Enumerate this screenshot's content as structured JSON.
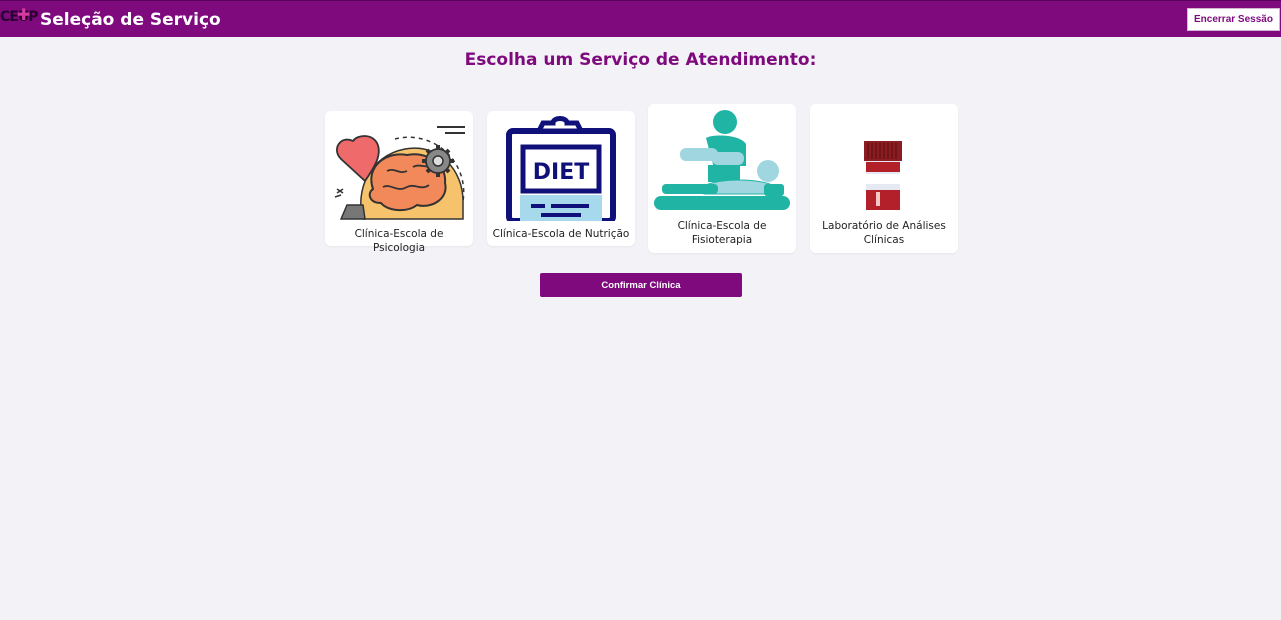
{
  "header": {
    "logo_text": "CEUP",
    "title": "Seleção de Serviço",
    "logout_label": "Encerrar Sessão",
    "background_color": "#7e0a7e"
  },
  "main": {
    "heading": "Escolha um Serviço de Atendimento:",
    "services": [
      {
        "label": "Clínica-Escola de Psicologia",
        "icon": "brain-heart-gear-icon"
      },
      {
        "label": "Clínica-Escola de Nutrição",
        "icon": "diet-clipboard-icon"
      },
      {
        "label": "Clínica-Escola de Fisioterapia",
        "icon": "physiotherapy-icon"
      },
      {
        "label": "Laboratório de Análises Clínicas",
        "icon": "blood-sample-tube-icon"
      }
    ],
    "confirm_label": "Confirmar Clínica"
  },
  "colors": {
    "accent": "#7e0a7e",
    "page_background": "#f3f2f6",
    "card_background": "#ffffff"
  }
}
